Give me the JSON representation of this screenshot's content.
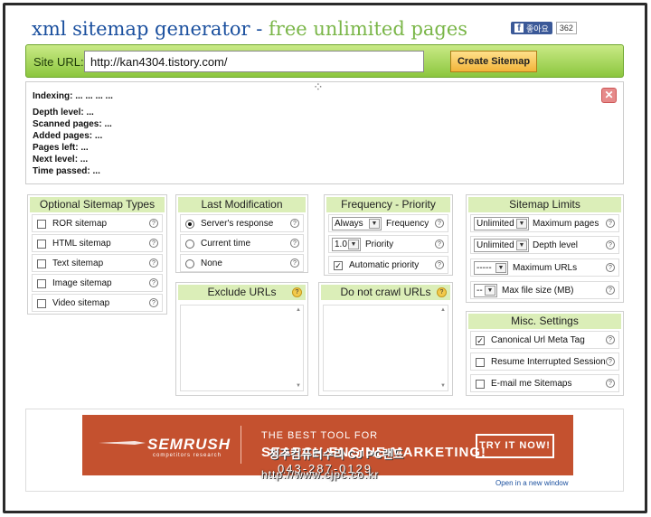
{
  "header": {
    "title_main": "xml sitemap generator - ",
    "title_free": "free unlimited pages",
    "fb_like": "좋아요",
    "fb_count": "362"
  },
  "urlbar": {
    "label": "Site URL:",
    "value": "http://kan4304.tistory.com/",
    "button": "Create Sitemap"
  },
  "status": {
    "rows": [
      "Indexing: ... ... ... ...",
      "Depth level:  ...",
      "Scanned pages: ...",
      "Added pages:  ...",
      "Pages left:  ...",
      "Next level:  ...",
      "Time passed:  ..."
    ],
    "close": "✕"
  },
  "optional_types": {
    "title": "Optional Sitemap Types",
    "items": [
      "ROR sitemap",
      "HTML sitemap",
      "Text sitemap",
      "Image sitemap",
      "Video sitemap"
    ]
  },
  "last_modification": {
    "title": "Last Modification",
    "items": [
      "Server's response",
      "Current time",
      "None"
    ],
    "selected": 0
  },
  "frequency_priority": {
    "title": "Frequency - Priority",
    "frequency_value": "Always",
    "frequency_label": "Frequency",
    "priority_value": "1.0",
    "priority_label": "Priority",
    "auto_label": "Automatic priority"
  },
  "sitemap_limits": {
    "title": "Sitemap Limits",
    "rows": [
      {
        "value": "Unlimited",
        "label": "Maximum pages"
      },
      {
        "value": "Unlimited",
        "label": "Depth level"
      },
      {
        "value": "-----",
        "label": "Maximum URLs"
      },
      {
        "value": "--",
        "label": "Max file size (MB)"
      }
    ]
  },
  "exclude_urls": {
    "title": "Exclude URLs"
  },
  "do_not_crawl": {
    "title": "Do not crawl URLs"
  },
  "misc_settings": {
    "title": "Misc. Settings",
    "items": [
      "Canonical Url Meta Tag",
      "Resume Interrupted Session",
      "E-mail me Sitemaps"
    ],
    "checked": [
      true,
      false,
      false
    ]
  },
  "ad": {
    "logo": "SEMRUSH",
    "sub": "competitors research",
    "tag1": "THE BEST TOOL FOR",
    "tag2": "SEARCH ENGINE MARKETING!",
    "button": "TRY IT NOW!",
    "open_new": "Open in a new window"
  },
  "watermark": {
    "name": "청주컴퓨터수리 CJ PC랜드",
    "phone": "043-287-0129",
    "url": "http://www.cjpc.co.kr"
  },
  "colors": {
    "title_blue": "#1a4f9e",
    "title_green": "#7ab648",
    "bar_green": "#8cc63e",
    "ad_bg": "#c4512f"
  }
}
